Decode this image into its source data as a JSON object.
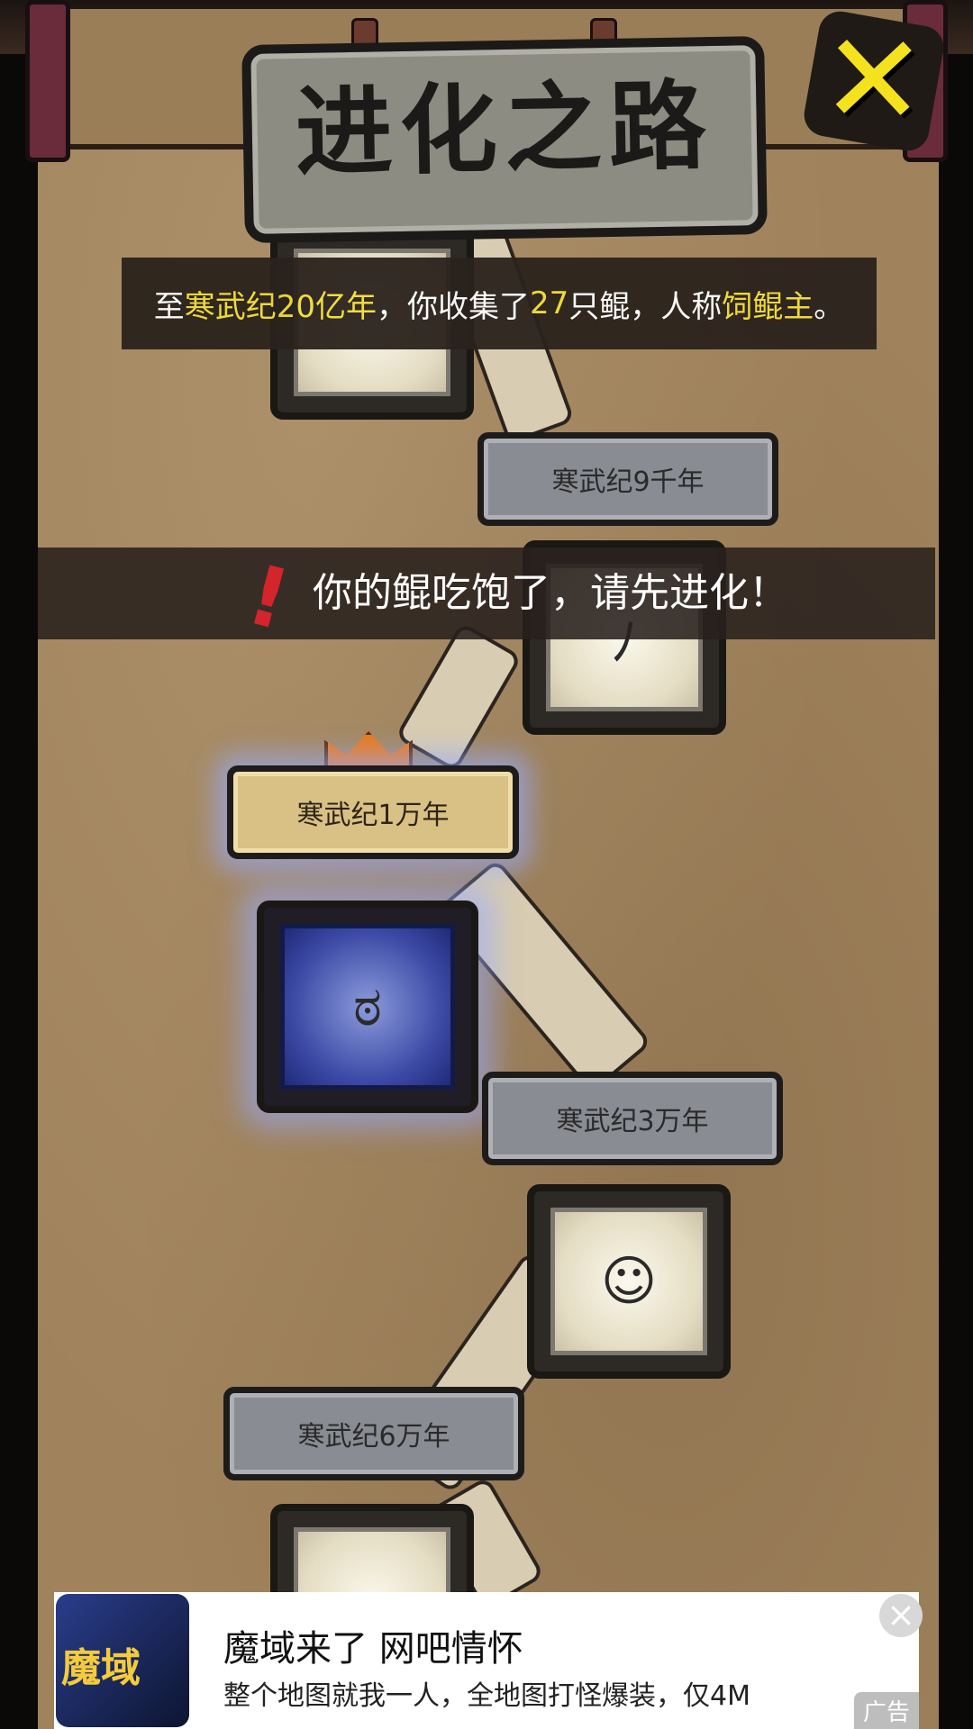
{
  "header": {
    "title": "进化之路",
    "close_icon": "close-x-icon"
  },
  "summary": {
    "prefix": "至",
    "era": "寒武纪20亿年",
    "middle": "，你收集了",
    "count": "27",
    "unit": "只鲲，人称",
    "honor": "饲鲲主",
    "suffix": "。"
  },
  "toast": {
    "message": "你的鲲吃饱了，请先进化！",
    "bang": "!"
  },
  "eras": [
    {
      "label": "寒武纪9千年",
      "current": false
    },
    {
      "label": "寒武纪1万年",
      "current": true
    },
    {
      "label": "寒武纪3万年",
      "current": false
    },
    {
      "label": "寒武纪6万年",
      "current": false
    }
  ],
  "ad": {
    "title": "魔域来了 网吧情怀",
    "description": "整个地图就我一人，全地图打怪爆装，仅4M",
    "icon_text": "魔域",
    "tag": "广告",
    "close": "×"
  },
  "colors": {
    "highlight": "#f2de39",
    "warning": "#d3252b",
    "current_glow": "#96aaff"
  }
}
